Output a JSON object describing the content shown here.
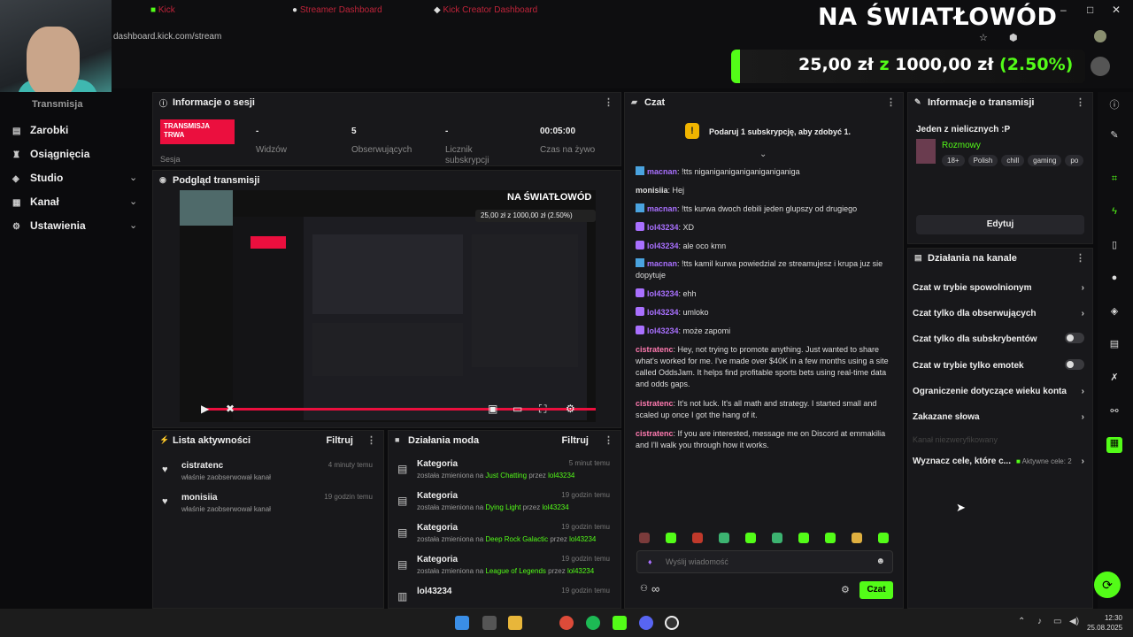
{
  "browser": {
    "tabs": [
      "Kick",
      "Streamer Dashboard",
      "Kick Creator Dashboard"
    ],
    "url": "dashboard.kick.com/stream"
  },
  "overlay": {
    "title": "NA ŚWIATŁOWÓD",
    "goal_current": "25,00 zł",
    "goal_sep": "z",
    "goal_target": "1000,00 zł",
    "goal_pct_label": "(2.50%)",
    "goal_fraction": 0.025
  },
  "nav": {
    "partial_item": "Transmisja",
    "items": [
      {
        "label": "Zarobki",
        "icon": "dollar-icon"
      },
      {
        "label": "Osiągnięcia",
        "icon": "trophy-icon"
      },
      {
        "label": "Studio",
        "icon": "studio-icon"
      },
      {
        "label": "Kanał",
        "icon": "channel-icon"
      },
      {
        "label": "Ustawienia",
        "icon": "gear-icon"
      }
    ]
  },
  "session": {
    "title": "Informacje o sesji",
    "badge": "TRANSMISJA TRWA",
    "badge_sub": "Sesja",
    "stats": [
      {
        "value": "-",
        "label": "Widzów"
      },
      {
        "value": "5",
        "label": "Obserwujących"
      },
      {
        "value": "-",
        "label": "Licznik subskrypcji"
      },
      {
        "value": "00:05:00",
        "label": "Czas na żywo"
      }
    ]
  },
  "preview": {
    "title": "Podgląd transmisji",
    "inner_title": "NA ŚWIATŁOWÓD",
    "inner_goal": "25,00 zł z 1000,00 zł (2.50%)"
  },
  "activity": {
    "title": "Lista aktywności",
    "filter": "Filtruj",
    "items": [
      {
        "name": "cistratenc",
        "desc": "właśnie zaobserwował kanał",
        "time": "4 minuty temu"
      },
      {
        "name": "monisiia",
        "desc": "właśnie zaobserwował kanał",
        "time": "19 godzin temu"
      }
    ]
  },
  "modactions": {
    "title": "Działania moda",
    "filter": "Filtruj",
    "items": [
      {
        "name": "Kategoria",
        "pre": "została zmieniona na",
        "cat": "Just Chatting",
        "by": "przez",
        "user": "lol43234",
        "time": "5 minut temu"
      },
      {
        "name": "Kategoria",
        "pre": "została zmieniona na",
        "cat": "Dying Light",
        "by": "przez",
        "user": "lol43234",
        "time": "19 godzin temu"
      },
      {
        "name": "Kategoria",
        "pre": "została zmieniona na",
        "cat": "Deep Rock Galactic",
        "by": "przez",
        "user": "lol43234",
        "time": "19 godzin temu"
      },
      {
        "name": "Kategoria",
        "pre": "została zmieniona na",
        "cat": "League of Legends",
        "by": "przez",
        "user": "lol43234",
        "time": "19 godzin temu"
      },
      {
        "name": "lol43234",
        "pre": "",
        "cat": "",
        "by": "",
        "user": "",
        "time": "19 godzin temu"
      }
    ]
  },
  "chat": {
    "title": "Czat",
    "promo": "Podaruj 1 subskrypcję, aby zdobyć 1.",
    "messages": [
      {
        "user": "macnan",
        "text": "!tts niganiganiganiganiganiganiga",
        "color": "#a970ff"
      },
      {
        "user": "monisiia",
        "text": "Hej",
        "color": "#dddddd"
      },
      {
        "user": "macnan",
        "text": "!tts kurwa dwoch debili jeden glupszy od drugiego",
        "color": "#a970ff"
      },
      {
        "user": "lol43234",
        "text": "XD",
        "color": "#a970ff"
      },
      {
        "user": "lol43234",
        "text": "ale oco kmn",
        "color": "#a970ff"
      },
      {
        "user": "macnan",
        "text": "!tts kamil kurwa powiedzial ze streamujesz i krupa juz sie dopytuje",
        "color": "#a970ff"
      },
      {
        "user": "lol43234",
        "text": "ehh",
        "color": "#a970ff"
      },
      {
        "user": "lol43234",
        "text": "umloko",
        "color": "#a970ff"
      },
      {
        "user": "lol43234",
        "text": "może zapomi",
        "color": "#a970ff"
      },
      {
        "user": "cistratenc",
        "text": "Hey, not trying to promote anything. Just wanted to share what's worked for me. I've made over $40K in a few months using a site called OddsJam. It helps find profitable sports bets using real-time data and odds gaps.",
        "color": "#ff7ab0"
      },
      {
        "user": "cistratenc",
        "text": "It's not luck. It's all math and strategy. I started small and scaled up once I got the hang of it.",
        "color": "#ff7ab0"
      },
      {
        "user": "cistratenc",
        "text": "If you are interested, message me on Discord at emmakilia and I'll walk you through how it works.",
        "color": "#ff7ab0"
      }
    ],
    "input_placeholder": "Wyślij wiadomość",
    "send_label": "Czat",
    "infinity": "∞"
  },
  "streaminfo": {
    "title": "Informacje o transmisji",
    "stream_title": "Jeden z nielicznych :P",
    "category": "Rozmowy",
    "tags": [
      "18+",
      "Polish",
      "chill",
      "gaming",
      "po"
    ],
    "edit_label": "Edytuj"
  },
  "channelactions": {
    "title": "Działania na kanale",
    "items": [
      {
        "label": "Czat w trybie spowolnionym",
        "kind": "chevron"
      },
      {
        "label": "Czat tylko dla obserwujących",
        "kind": "chevron"
      },
      {
        "label": "Czat tylko dla subskrybentów",
        "kind": "toggle"
      },
      {
        "label": "Czat w trybie tylko emotek",
        "kind": "toggle"
      },
      {
        "label": "Ograniczenie dotyczące wieku konta",
        "kind": "chevron"
      },
      {
        "label": "Zakazane słowa",
        "kind": "chevron"
      }
    ],
    "faded": "Kanał niezweryfikowany",
    "goals_label": "Wyznacz cele, które c...",
    "goals_badge": "Aktywne cele: 2"
  },
  "clock": {
    "time": "12:30",
    "date": "25.08.2025"
  }
}
